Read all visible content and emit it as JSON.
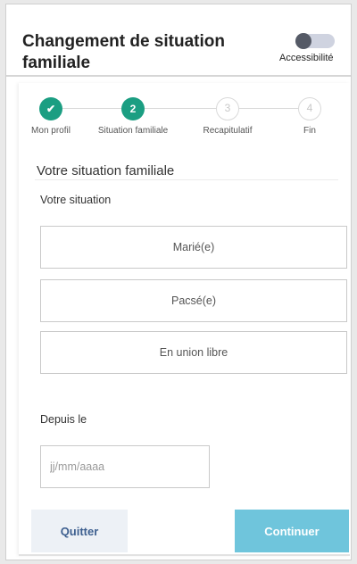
{
  "header": {
    "title": "Changement de situation familiale",
    "accessibility_label": "Accessibilité",
    "accessibility_enabled": false
  },
  "steps": [
    {
      "number": "✔",
      "label": "Mon profil",
      "state": "done"
    },
    {
      "number": "2",
      "label": "Situation familiale",
      "state": "active"
    },
    {
      "number": "3",
      "label": "Recapitulatif",
      "state": "todo"
    },
    {
      "number": "4",
      "label": "Fin",
      "state": "todo"
    }
  ],
  "form": {
    "section_title": "Votre situation familiale",
    "situation_label": "Votre situation",
    "options": [
      "Marié(e)",
      "Pacsé(e)",
      "En union libre"
    ],
    "date_label": "Depuis le",
    "date_placeholder": "jj/mm/aaaa",
    "date_value": ""
  },
  "actions": {
    "quit_label": "Quitter",
    "continue_label": "Continuer"
  },
  "colors": {
    "step_active": "#1b9e82",
    "continue_button": "#6fc5dc",
    "quit_button_bg": "#edf1f6",
    "quit_button_text": "#3d5f8f"
  }
}
